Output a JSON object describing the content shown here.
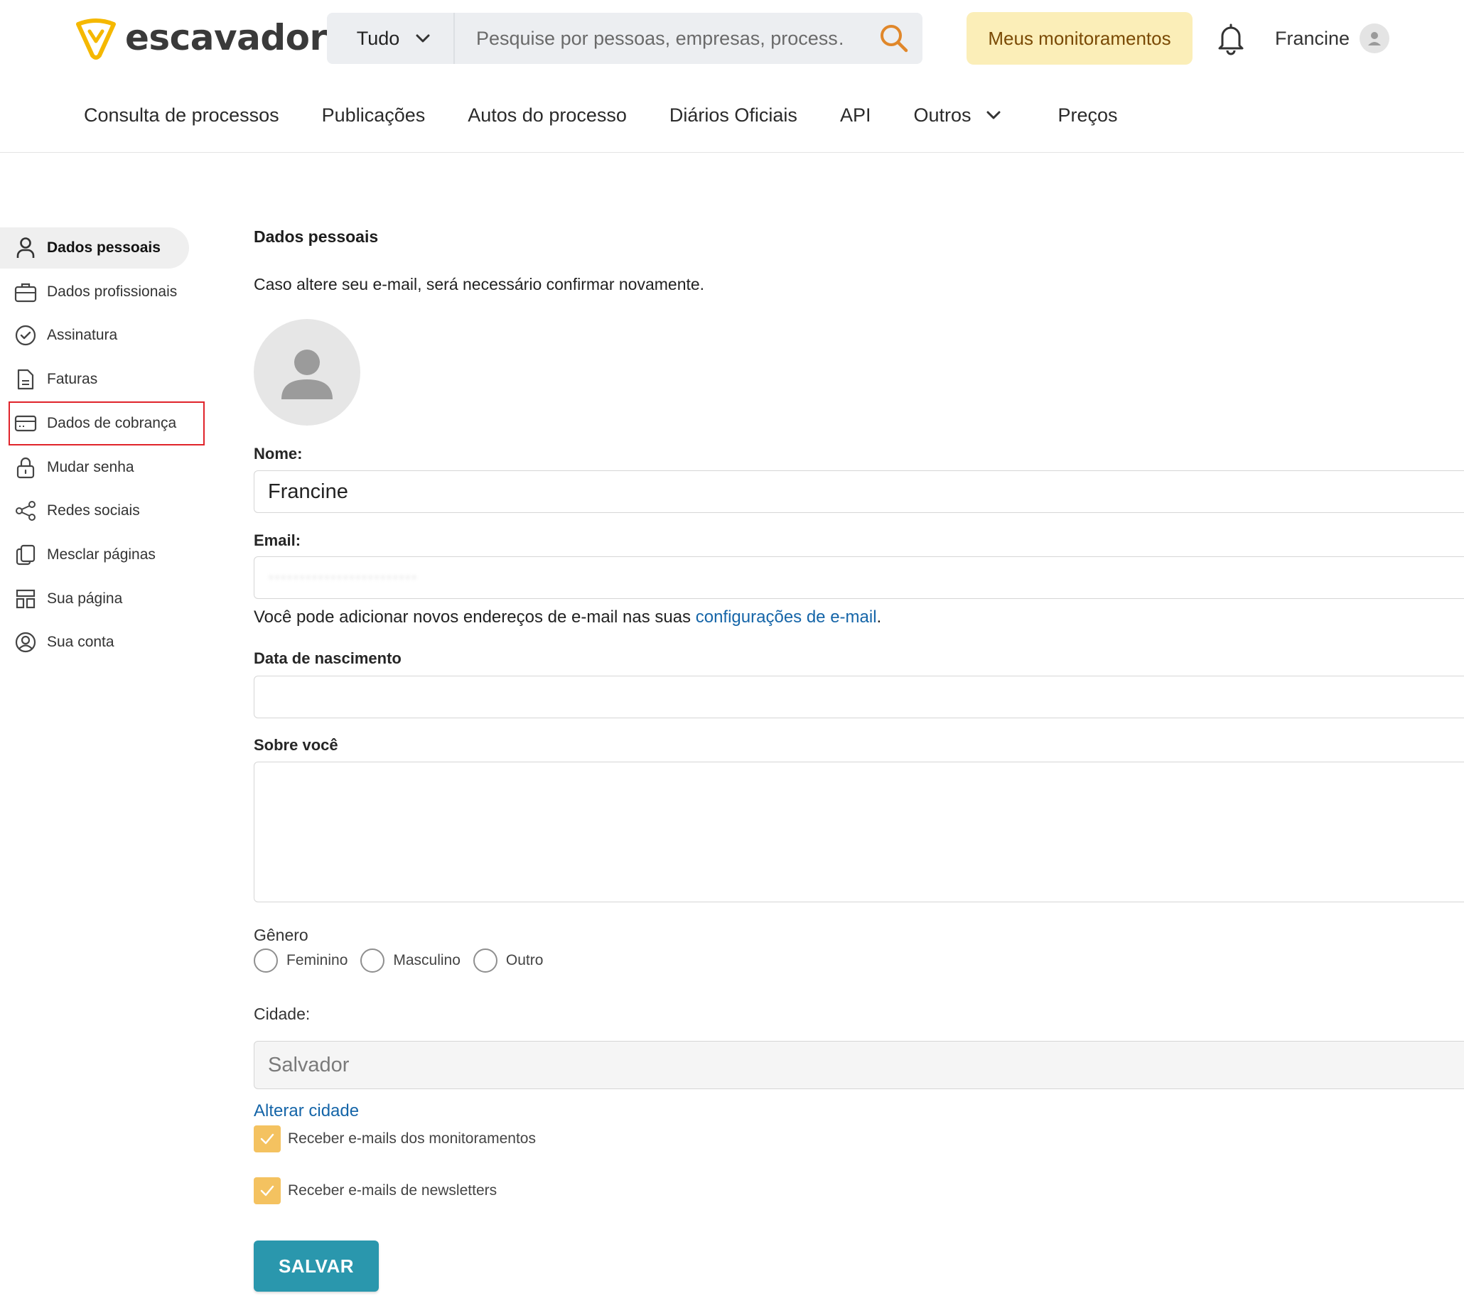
{
  "brand": {
    "name": "escavador",
    "accent": "#f5b800"
  },
  "search": {
    "scope": "Tudo",
    "placeholder": "Pesquise por pessoas, empresas, process…"
  },
  "header": {
    "monitor_button": "Meus monitoramentos",
    "user_name": "Francine"
  },
  "nav": [
    "Consulta de processos",
    "Publicações",
    "Autos do processo",
    "Diários Oficiais",
    "API",
    "Outros",
    "Preços"
  ],
  "sidebar": {
    "items": [
      {
        "label": "Dados pessoais",
        "icon": "user-icon",
        "active": true
      },
      {
        "label": "Dados profissionais",
        "icon": "briefcase-icon"
      },
      {
        "label": "Assinatura",
        "icon": "badge-check-icon"
      },
      {
        "label": "Faturas",
        "icon": "document-icon"
      },
      {
        "label": "Dados de cobrança",
        "icon": "credit-card-icon",
        "highlighted": true
      },
      {
        "label": "Mudar senha",
        "icon": "lock-icon"
      },
      {
        "label": "Redes sociais",
        "icon": "share-icon"
      },
      {
        "label": "Mesclar páginas",
        "icon": "copy-icon"
      },
      {
        "label": "Sua página",
        "icon": "layout-icon"
      },
      {
        "label": "Sua conta",
        "icon": "user-circle-icon"
      }
    ]
  },
  "main": {
    "title": "Dados pessoais",
    "lead": "Caso altere seu e-mail, será necessário confirmar novamente.",
    "name_label": "Nome:",
    "name_value": "Francine",
    "email_label": "Email:",
    "email_help_prefix": "Você pode adicionar novos endereços de e-mail nas suas ",
    "email_help_link": "configurações de e-mail",
    "email_help_suffix": ".",
    "birth_label": "Data de nascimento",
    "about_label": "Sobre você",
    "gender_label": "Gênero",
    "gender_options": [
      "Feminino",
      "Masculino",
      "Outro"
    ],
    "city_label": "Cidade:",
    "city_value": "Salvador",
    "change_city": "Alterar cidade",
    "checkboxes": [
      {
        "label": "Receber e-mails dos monitoramentos",
        "checked": true
      },
      {
        "label": "Receber e-mails de newsletters",
        "checked": true
      }
    ],
    "save": "SALVAR"
  }
}
